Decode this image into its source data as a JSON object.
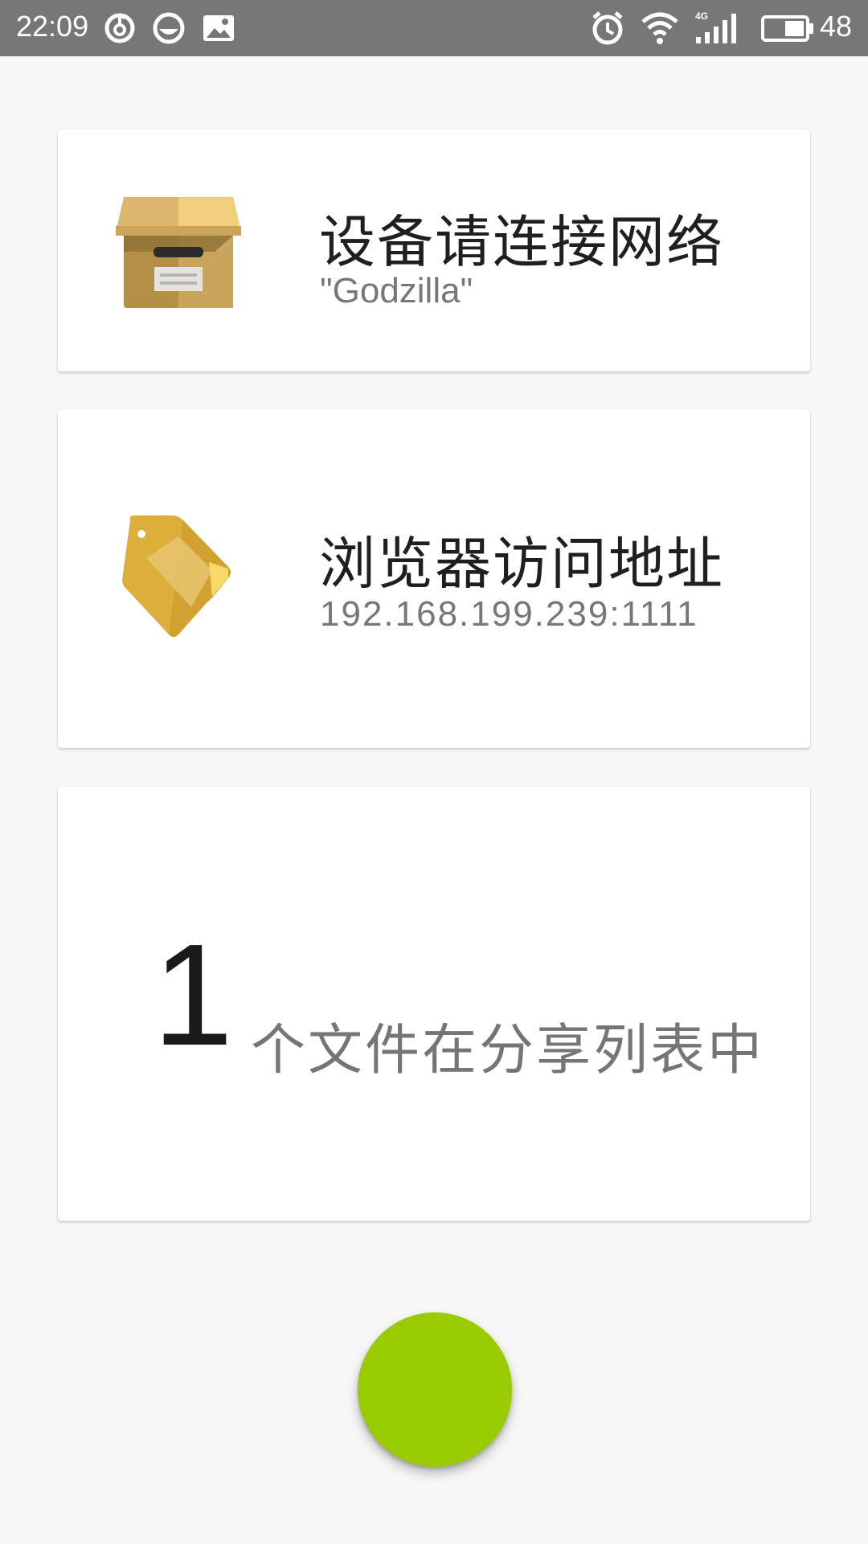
{
  "status_bar": {
    "time": "22:09",
    "left_icons": [
      "netease-music-icon",
      "app-notification-icon",
      "image-notification-icon"
    ],
    "right_icons": [
      "alarm-icon",
      "wifi-icon",
      "signal-4g-icon",
      "battery-icon"
    ],
    "network_type": "4G",
    "battery_level": "48"
  },
  "network_card": {
    "icon": "archive-box-icon",
    "title": "设备请连接网络",
    "network_name": "\"Godzilla\""
  },
  "address_card": {
    "icon": "tag-icon",
    "title": "浏览器访问地址",
    "address": "192.168.199.239:1111"
  },
  "files_card": {
    "count": "1",
    "label": "个文件在分享列表中"
  },
  "colors": {
    "status_bar": "#777777",
    "background": "#f7f7f7",
    "fab": "#99cc00",
    "box": "#c9a45a",
    "tag": "#e0b23a"
  }
}
